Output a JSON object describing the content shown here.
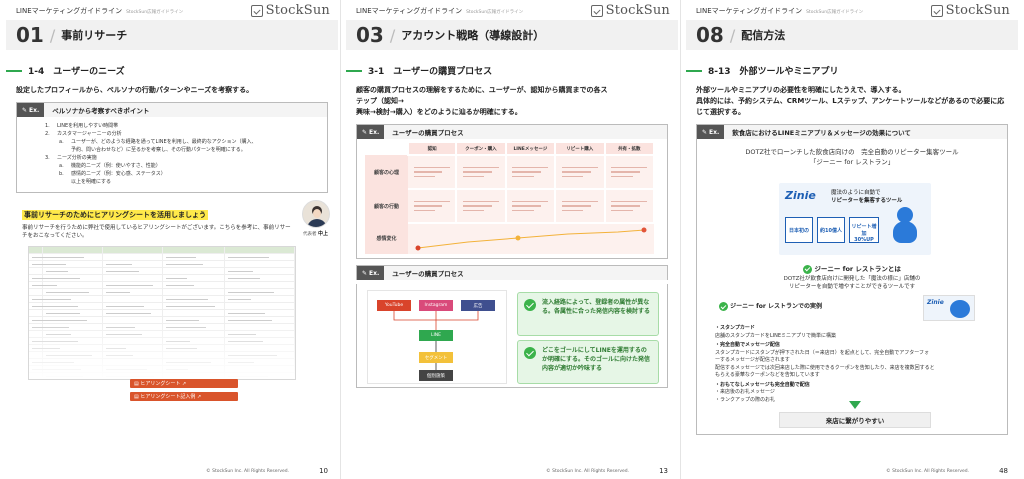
{
  "common": {
    "guide_title": "LINEマーケティングガイドライン",
    "guide_sub": "StockSun広報ガイドライン",
    "logo": "StockSun",
    "copyright": "© StockSun Inc. All Rights Reserved.",
    "ex_badge": "Ex."
  },
  "page1": {
    "chapter_num": "01",
    "chapter_title": "事前リサーチ",
    "section": "1-4　ユーザーのニーズ",
    "lead": "設定したプロフィールから、ペルソナの行動パターンやニーズを考察する。",
    "box_title": "ペルソナから考察すべきポイント",
    "list": [
      {
        "num": "1.",
        "text": "LINEを利用しやすい時間帯",
        "level": 1
      },
      {
        "num": "2.",
        "text": "カスタマージャーニーの分析",
        "level": 1
      },
      {
        "num": "a.",
        "text": "ユーザーが、どのような経路を通ってLINEを利用し、最終的なアクション（購入、",
        "level": 2
      },
      {
        "num": "",
        "text": "予約、問い合わせなど）に至るかを考察し、その行動パターンを明確にする。",
        "level": 2
      },
      {
        "num": "3.",
        "text": "ニーズ分析の実施",
        "level": 1
      },
      {
        "num": "a.",
        "text": "機能的ニーズ（例：使いやすさ、性能）",
        "level": 2
      },
      {
        "num": "b.",
        "text": "感情的ニーズ（例：安心感、ステータス）",
        "level": 2
      },
      {
        "num": "",
        "text": "以上を明確にする",
        "level": 2
      }
    ],
    "hearing_title": "事前リサーチのためにヒアリングシートを活用しましょう",
    "hearing_text": "事前リサーチを行うために弊社で使用しているヒアリングシートがございます。こちらを参考に、事前リサーチをおこなってください。",
    "avatar_role": "代表者",
    "avatar_name": "中上",
    "btn1": "ヒアリングシート",
    "btn2": "ヒアリングシート記入例",
    "page_num": "10"
  },
  "page2": {
    "chapter_num": "03",
    "chapter_title": "アカウント戦略（導線設計）",
    "section": "3-1　ユーザーの購買プロセス",
    "lead_line1": "顧客の購買プロセスの理解をするために、ユーザーが、認知から購買までの各ス",
    "lead_line2": "テップ（認知→",
    "lead_line3": "興味→検討→購入）をどのように辿るか明確にする。",
    "box1_title": "ユーザーの購買プロセス",
    "stages": [
      "認知",
      "クーポン・購入",
      "LINEメッセージ",
      "リピート購入",
      "共有・拡散"
    ],
    "rows": [
      "顧客の心理",
      "顧客の行動",
      "感情変化"
    ],
    "box2_title": "ユーザーの購買プロセス",
    "channels": [
      "YouTube",
      "Instagram",
      "広告"
    ],
    "flow_nodes": [
      "LINE",
      "セグメント",
      "個別施策"
    ],
    "callout1": "流入経路によって、登録者の属性が異なる。各属性に合った発信内容を検討する",
    "callout2": "どこをゴールにしてLINEを運用するのか明確にする。そのゴールに向けた発信内容が適切か吟味する",
    "page_num": "13"
  },
  "page3": {
    "chapter_num": "08",
    "chapter_title": "配信方法",
    "section": "8-13　外部ツールやミニアプリ",
    "lead_line1": "外部ツールやミニアプリの必要性を明確にしたうえで、導入する。",
    "lead_line2": "具体的には、予約システム、CRMツール、Lステップ、アンケートツールなどがあるので必要に応じて選択する。",
    "box_title": "飲食店におけるLINEミニアプリ＆メッセージの効果について",
    "intro_line1": "DOTZ社でローンチした飲食店向けの　完全自動のリピーター集客ツール",
    "intro_line2": "「ジーニー for レストラン」",
    "promo_brand": "Zinie",
    "promo_line1": "魔法のように自動で",
    "promo_line2": "リピーターを集客するツール",
    "promo_b1": "日本初の",
    "promo_b2": "約10億人",
    "promo_b3": "リピート増加",
    "promo_b4": "30%UP",
    "what_title": "ジーニー for レストランとは",
    "what_line1": "DOTZ社が飲食店向けに開発した「魔法の様に」店舗の",
    "what_line2": "リピーターを自動で増やすことができるツールです",
    "case_title": "ジーニー for レストランでの実例",
    "c1_title": "・スタンプカード",
    "c1_text": "店舗のスタンプカードをLINEミニアプリで簡単に構築",
    "c2_title": "・完全自動でメッセージ配信",
    "c2_l1": "スタンプカードにスタンプが押下された日（＝来店日）を起点として、完全自動でアフターフォ",
    "c2_l2": "ーするメッセージが配信されます",
    "c2_l3": "配信するメッセージでは次回来店した際に使用できるクーポンを告知したり、来店を複数回すると",
    "c2_l4": "もらえる豪華なクーポンなどを告知しています",
    "c3_title": "・おもてなしメッセージも完全自動で配信",
    "c3_l1": "・来店後のお礼メッセージ",
    "c3_l2": "・ランクアップの際のお礼",
    "result": "来店に繋がりやすい",
    "page_num": "48"
  },
  "colors": {
    "green": "#2fa84f",
    "highlight": "#ffe94a",
    "orange": "#d9542b",
    "pink": "#fbe3df"
  }
}
